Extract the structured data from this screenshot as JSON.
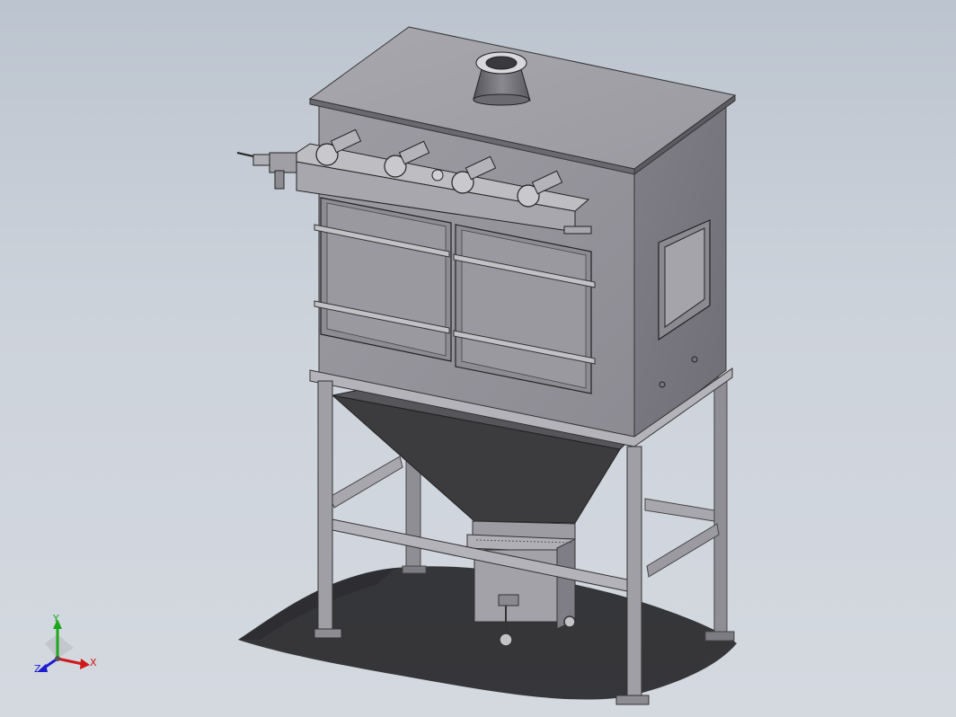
{
  "triad": {
    "x_label": "X",
    "y_label": "Y",
    "z_label": "Z",
    "x_color": "#d01818",
    "y_color": "#1aa81a",
    "z_color": "#1c1cd0"
  },
  "model": {
    "body_color": "#8a8990",
    "shade_dark": "#5a5a5f",
    "hopper_color": "#3c3c3f"
  }
}
